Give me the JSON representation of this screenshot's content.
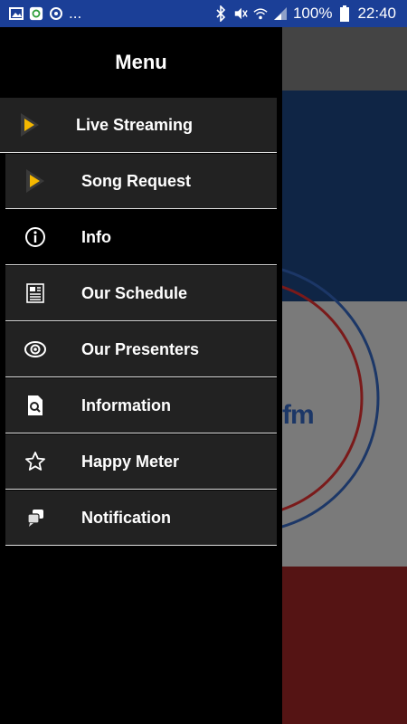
{
  "status_bar": {
    "ellipsis": "...",
    "battery": "100%",
    "time": "22:40"
  },
  "background": {
    "logo_text": "fm"
  },
  "drawer": {
    "title": "Menu",
    "items": [
      {
        "label": "Live Streaming",
        "icon": "play-arrow-icon"
      },
      {
        "label": "Song Request",
        "icon": "play-arrow-icon"
      },
      {
        "label": "Info",
        "icon": "info-icon"
      },
      {
        "label": "Our Schedule",
        "icon": "newspaper-icon"
      },
      {
        "label": "Our Presenters",
        "icon": "eye-icon"
      },
      {
        "label": "Information",
        "icon": "document-search-icon"
      },
      {
        "label": "Happy Meter",
        "icon": "star-icon"
      },
      {
        "label": "Notification",
        "icon": "chat-bubbles-icon"
      }
    ]
  },
  "colors": {
    "status_bar": "#1b3f97",
    "accent_play": "#f5b800",
    "drawer_bg": "#000000",
    "item_bg": "#222222"
  }
}
